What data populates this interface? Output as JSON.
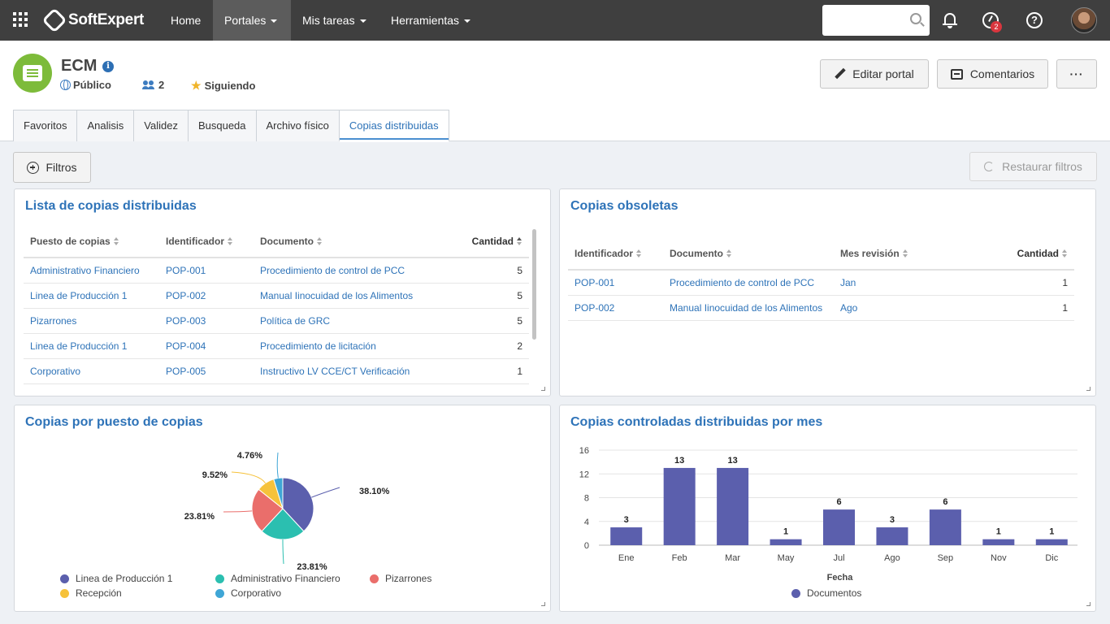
{
  "nav": {
    "logo": "SoftExpert",
    "items": [
      {
        "label": "Home"
      },
      {
        "label": "Portales"
      },
      {
        "label": "Mis tareas"
      },
      {
        "label": "Herramientas"
      }
    ],
    "search_placeholder": "",
    "notifications_badge": "2"
  },
  "portal": {
    "title": "ECM",
    "visibility": "Público",
    "members": "2",
    "follow": "Siguiendo",
    "edit_label": "Editar portal",
    "comments_label": "Comentarios",
    "more_label": "···"
  },
  "tabs": [
    "Favoritos",
    "Analisis",
    "Validez",
    "Busqueda",
    "Archivo físico",
    "Copias distribuidas"
  ],
  "toolbar": {
    "filters": "Filtros",
    "restore": "Restaurar filtros"
  },
  "list_panel": {
    "title": "Lista de copias distribuidas",
    "columns": [
      "Puesto de copias",
      "Identificador",
      "Documento",
      "Cantidad"
    ],
    "rows": [
      [
        "Administrativo Financiero",
        "POP-001",
        "Procedimiento de control de PCC",
        "5"
      ],
      [
        "Linea de Producción 1",
        "POP-002",
        "Manual Iinocuidad de los Alimentos",
        "5"
      ],
      [
        "Pizarrones",
        "POP-003",
        "Política de GRC",
        "5"
      ],
      [
        "Linea de Producción 1",
        "POP-004",
        "Procedimiento de licitación",
        "2"
      ],
      [
        "Corporativo",
        "POP-005",
        "Instructivo LV CCE/CT Verificación",
        "1"
      ]
    ]
  },
  "obsolete_panel": {
    "title": "Copias obsoletas",
    "columns": [
      "Identificador",
      "Documento",
      "Mes revisión",
      "Cantidad"
    ],
    "rows": [
      [
        "POP-001",
        "Procedimiento de control de PCC",
        "Jan",
        "1"
      ],
      [
        "POP-002",
        "Manual Iinocuidad de los Alimentos",
        "Ago",
        "1"
      ]
    ]
  },
  "pie_panel": {
    "title": "Copias por puesto de copias"
  },
  "bar_panel": {
    "title": "Copias controladas distribuidas por mes"
  },
  "chart_data": [
    {
      "type": "pie",
      "title": "Copias por puesto de copias",
      "slices": [
        {
          "label": "Linea de Producción 1",
          "value": 38.1,
          "text": "38.10%",
          "color": "#5b5fad"
        },
        {
          "label": "Administrativo Financiero",
          "value": 23.81,
          "text": "23.81%",
          "color": "#2bbfb0"
        },
        {
          "label": "Pizarrones",
          "value": 23.81,
          "text": "23.81%",
          "color": "#ea6e6b"
        },
        {
          "label": "Recepción",
          "value": 9.52,
          "text": "9.52%",
          "color": "#f6c23b"
        },
        {
          "label": "Corporativo",
          "value": 4.76,
          "text": "4.76%",
          "color": "#3fa6d6"
        }
      ],
      "legend_position": "bottom"
    },
    {
      "type": "bar",
      "title": "Copias controladas distribuidas por mes",
      "categories": [
        "Ene",
        "Feb",
        "Mar",
        "May",
        "Jul",
        "Ago",
        "Sep",
        "Nov",
        "Dic"
      ],
      "series": [
        {
          "name": "Documentos",
          "values": [
            3,
            13,
            13,
            1,
            6,
            3,
            6,
            1,
            1
          ],
          "color": "#5b5fad"
        }
      ],
      "xlabel": "Fecha",
      "ylabel": "",
      "ylim": [
        0,
        16
      ],
      "yticks": [
        0,
        4,
        8,
        12,
        16
      ],
      "grid": true,
      "legend_position": "bottom"
    }
  ]
}
